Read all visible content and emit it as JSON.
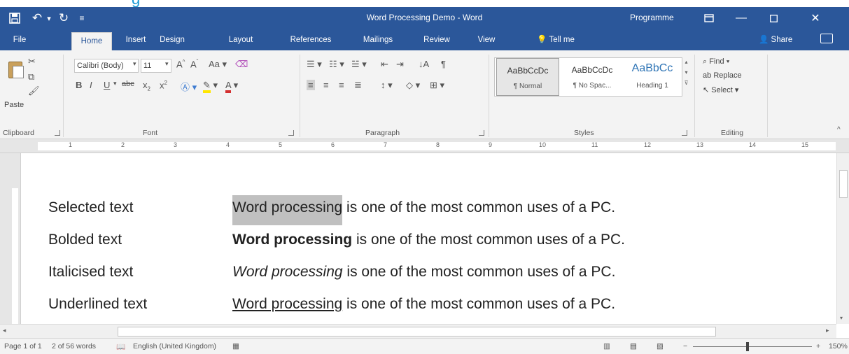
{
  "heading_fragment": "g",
  "titlebar": {
    "title": "Word Processing Demo  -  Word",
    "account": "Programme",
    "save_icon": "save-icon",
    "undo_icon": "undo-icon",
    "redo_icon": "redo-icon"
  },
  "tabs": [
    "File",
    "Home",
    "Insert",
    "Design",
    "Layout",
    "References",
    "Mailings",
    "Review",
    "View"
  ],
  "tell_me": "Tell me",
  "share": "Share",
  "ribbon": {
    "clipboard": {
      "paste": "Paste",
      "label": "Clipboard"
    },
    "font": {
      "name": "Calibri (Body)",
      "size": "11",
      "label": "Font"
    },
    "paragraph": {
      "label": "Paragraph"
    },
    "styles": {
      "label": "Styles",
      "items": [
        {
          "sample": "AaBbCcDc",
          "name": "¶ Normal"
        },
        {
          "sample": "AaBbCcDc",
          "name": "¶ No Spac..."
        },
        {
          "sample": "AaBbCc",
          "name": "Heading 1"
        }
      ]
    },
    "editing": {
      "find": "Find",
      "replace": "Replace",
      "select": "Select",
      "label": "Editing"
    }
  },
  "ruler_numbers": [
    "1",
    "2",
    "3",
    "4",
    "5",
    "6",
    "7",
    "8",
    "9",
    "10",
    "11",
    "12",
    "13",
    "14",
    "15"
  ],
  "document": {
    "rows": [
      {
        "label": "Selected text",
        "phrase": "Word processing",
        "rest": " is one of the most common uses of a PC."
      },
      {
        "label": "Bolded text",
        "phrase": "Word processing",
        "rest": " is one of the most common uses of a PC."
      },
      {
        "label": "Italicised text",
        "phrase": "Word processing",
        "rest": " is one of the most common uses of a PC."
      },
      {
        "label": "Underlined text",
        "phrase": "Word processing",
        "rest": " is one of the most common uses of a PC."
      }
    ]
  },
  "status": {
    "page": "Page 1 of 1",
    "words": "2 of 56 words",
    "language": "English (United Kingdom)",
    "zoom": "150%"
  },
  "colors": {
    "word_blue": "#2b579a",
    "ribbon_bg": "#f3f3f3",
    "selection": "#c0c0c0"
  }
}
